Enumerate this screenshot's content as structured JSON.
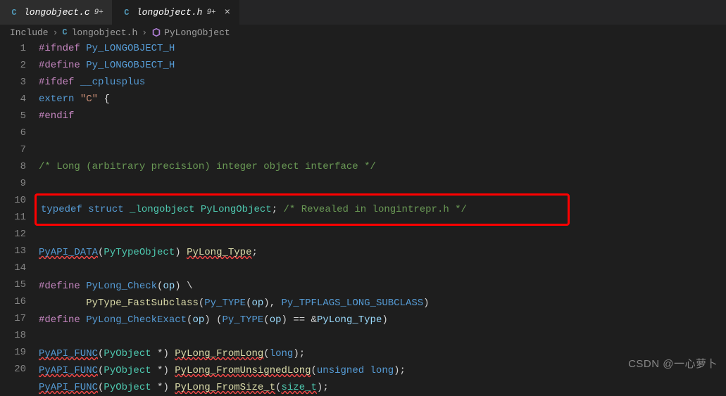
{
  "tabs": [
    {
      "icon": "C",
      "name": "longobject.c",
      "modified": "9+",
      "active": false
    },
    {
      "icon": "C",
      "name": "longobject.h",
      "modified": "9+",
      "active": true
    }
  ],
  "breadcrumbs": {
    "folder": "Include",
    "fileIcon": "C",
    "file": "longobject.h",
    "symbol": "PyLongObject"
  },
  "code": {
    "l1": {
      "k1": "#ifndef",
      "m": "Py_LONGOBJECT_H"
    },
    "l2": {
      "k1": "#define",
      "m": "Py_LONGOBJECT_H"
    },
    "l3": {
      "k1": "#ifdef",
      "m": "__cplusplus"
    },
    "l4": {
      "kw": "extern",
      "s": "\"C\"",
      "b": "{"
    },
    "l5": {
      "k1": "#endif"
    },
    "l8": {
      "c": "/* Long (arbitrary precision) integer object interface */"
    },
    "l10": {
      "kw1": "typedef",
      "kw2": "struct",
      "id": "_longobject",
      "ty": "PyLongObject",
      "sc": ";",
      "c": "/* Revealed in longintrepr.h */"
    },
    "l12": {
      "fn": "PyAPI_DATA",
      "lp": "(",
      "ty": "PyTypeObject",
      "rp": ")",
      "id": "PyLong_Type",
      "sc": ";"
    },
    "l14": {
      "k1": "#define",
      "m": "PyLong_Check",
      "lp": "(",
      "p": "op",
      "rp": ")",
      "bs": "\\"
    },
    "l15": {
      "fn": "PyType_FastSubclass",
      "lp": "(",
      "m1": "Py_TYPE",
      "lp2": "(",
      "p": "op",
      "rp2": ")",
      "cm": ",",
      "m2": "Py_TPFLAGS_LONG_SUBCLASS",
      "rp": ")"
    },
    "l16": {
      "k1": "#define",
      "m": "PyLong_CheckExact",
      "lp": "(",
      "p": "op",
      "rp": ")",
      "sp": " (",
      "m1": "Py_TYPE",
      "lp2": "(",
      "p2": "op",
      "rp2": ")",
      "eq": " == ",
      "amp": "&",
      "id": "PyLong_Type",
      "rpp": ")"
    },
    "l18": {
      "fn": "PyAPI_FUNC",
      "lp": "(",
      "ty": "PyObject",
      "star": " *",
      "rp": ")",
      "id": "PyLong_FromLong",
      "lp2": "(",
      "ty2": "long",
      "rp2": ")",
      "sc": ";"
    },
    "l19": {
      "fn": "PyAPI_FUNC",
      "lp": "(",
      "ty": "PyObject",
      "star": " *",
      "rp": ")",
      "id": "PyLong_FromUnsignedLong",
      "lp2": "(",
      "ty2": "unsigned",
      "ty3": " long",
      "rp2": ")",
      "sc": ";"
    },
    "l20": {
      "fn": "PyAPI_FUNC",
      "lp": "(",
      "ty": "PyObject",
      "star": " *",
      "rp": ")",
      "id": "PyLong_FromSize_t",
      "lp2": "(",
      "ty2": "size_t",
      "rp2": ")",
      "sc": ";"
    }
  },
  "lineNumbers": [
    "1",
    "2",
    "3",
    "4",
    "5",
    "6",
    "7",
    "8",
    "9",
    "10",
    "11",
    "12",
    "13",
    "14",
    "15",
    "16",
    "17",
    "18",
    "19",
    "20"
  ],
  "watermark": "CSDN @一心萝卜"
}
